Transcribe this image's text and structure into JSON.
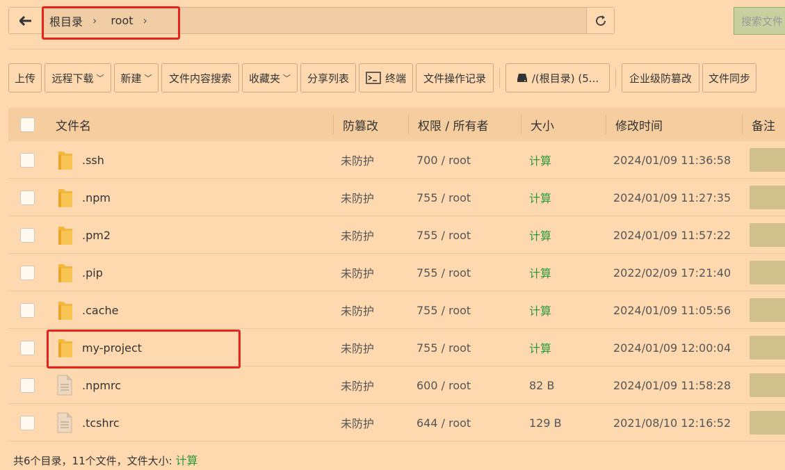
{
  "pathbar": {
    "crumbs": [
      "根目录",
      "root"
    ],
    "search_label": "搜索文件"
  },
  "toolbar": {
    "upload": "上传",
    "remote_download": "远程下载",
    "new": "新建",
    "content_search": "文件内容搜索",
    "favorites": "收藏夹",
    "share_list": "分享列表",
    "terminal": "终端",
    "op_log": "文件操作记录",
    "disk": "/(根目录) (5...",
    "tamper": "企业级防篡改",
    "sync": "文件同步"
  },
  "table": {
    "headers": {
      "name": "文件名",
      "tamper": "防篡改",
      "perm": "权限 / 所有者",
      "size": "大小",
      "mtime": "修改时间",
      "remark": "备注"
    },
    "rows": [
      {
        "type": "folder",
        "name": ".ssh",
        "tamper": "未防护",
        "perm": "700 / root",
        "size": "计算",
        "mtime": "2024/01/09 11:36:58"
      },
      {
        "type": "folder",
        "name": ".npm",
        "tamper": "未防护",
        "perm": "755 / root",
        "size": "计算",
        "mtime": "2024/01/09 11:27:35"
      },
      {
        "type": "folder",
        "name": ".pm2",
        "tamper": "未防护",
        "perm": "755 / root",
        "size": "计算",
        "mtime": "2024/01/09 11:57:22"
      },
      {
        "type": "folder",
        "name": ".pip",
        "tamper": "未防护",
        "perm": "755 / root",
        "size": "计算",
        "mtime": "2022/02/09 17:21:40"
      },
      {
        "type": "folder",
        "name": ".cache",
        "tamper": "未防护",
        "perm": "755 / root",
        "size": "计算",
        "mtime": "2024/01/09 11:05:56"
      },
      {
        "type": "folder",
        "name": "my-project",
        "tamper": "未防护",
        "perm": "755 / root",
        "size": "计算",
        "mtime": "2024/01/09 12:00:04"
      },
      {
        "type": "file",
        "name": ".npmrc",
        "tamper": "未防护",
        "perm": "600 / root",
        "size": "82 B",
        "mtime": "2024/01/09 11:58:28"
      },
      {
        "type": "file",
        "name": ".tcshrc",
        "tamper": "未防护",
        "perm": "644 / root",
        "size": "129 B",
        "mtime": "2021/08/10 12:16:52"
      }
    ]
  },
  "footer": {
    "summary": "共6个目录，11个文件，文件大小:",
    "calc": "计算"
  },
  "colors": {
    "background": "#fed9b0",
    "accent_green": "#2c9a3b",
    "highlight_red": "#e8231e",
    "folder": "#f5b73b"
  }
}
